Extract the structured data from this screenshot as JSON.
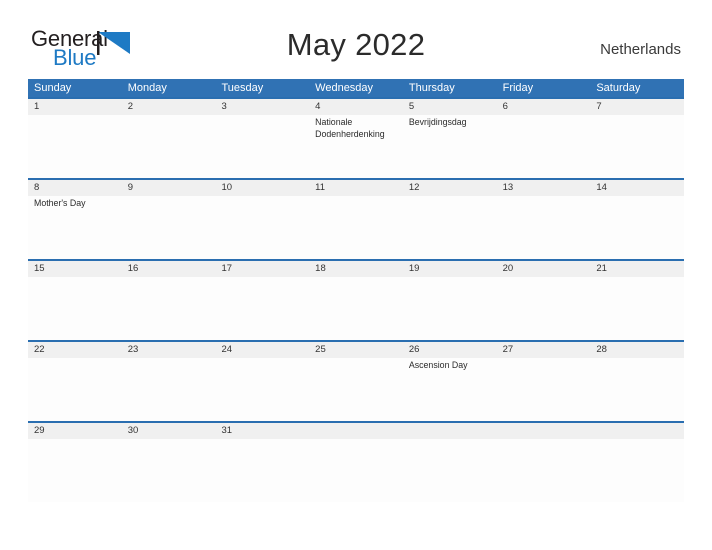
{
  "brand": {
    "name_part1": "General",
    "name_part2": "Blue",
    "accent_color": "#1e7ac4",
    "flag_icon": "triangle-flag-icon"
  },
  "header": {
    "title": "May 2022",
    "country": "Netherlands",
    "header_bg_color": "#3072b4",
    "row_divider_color": "#2a6eb0",
    "date_band_color": "#f0f0f0"
  },
  "calendar": {
    "day_names": [
      "Sunday",
      "Monday",
      "Tuesday",
      "Wednesday",
      "Thursday",
      "Friday",
      "Saturday"
    ],
    "weeks": [
      [
        {
          "date": "1",
          "event": ""
        },
        {
          "date": "2",
          "event": ""
        },
        {
          "date": "3",
          "event": ""
        },
        {
          "date": "4",
          "event": "Nationale Dodenherdenking"
        },
        {
          "date": "5",
          "event": "Bevrijdingsdag"
        },
        {
          "date": "6",
          "event": ""
        },
        {
          "date": "7",
          "event": ""
        }
      ],
      [
        {
          "date": "8",
          "event": "Mother's Day"
        },
        {
          "date": "9",
          "event": ""
        },
        {
          "date": "10",
          "event": ""
        },
        {
          "date": "11",
          "event": ""
        },
        {
          "date": "12",
          "event": ""
        },
        {
          "date": "13",
          "event": ""
        },
        {
          "date": "14",
          "event": ""
        }
      ],
      [
        {
          "date": "15",
          "event": ""
        },
        {
          "date": "16",
          "event": ""
        },
        {
          "date": "17",
          "event": ""
        },
        {
          "date": "18",
          "event": ""
        },
        {
          "date": "19",
          "event": ""
        },
        {
          "date": "20",
          "event": ""
        },
        {
          "date": "21",
          "event": ""
        }
      ],
      [
        {
          "date": "22",
          "event": ""
        },
        {
          "date": "23",
          "event": ""
        },
        {
          "date": "24",
          "event": ""
        },
        {
          "date": "25",
          "event": ""
        },
        {
          "date": "26",
          "event": "Ascension Day"
        },
        {
          "date": "27",
          "event": ""
        },
        {
          "date": "28",
          "event": ""
        }
      ],
      [
        {
          "date": "29",
          "event": ""
        },
        {
          "date": "30",
          "event": ""
        },
        {
          "date": "31",
          "event": ""
        },
        {
          "date": "",
          "event": ""
        },
        {
          "date": "",
          "event": ""
        },
        {
          "date": "",
          "event": ""
        },
        {
          "date": "",
          "event": ""
        }
      ]
    ]
  }
}
